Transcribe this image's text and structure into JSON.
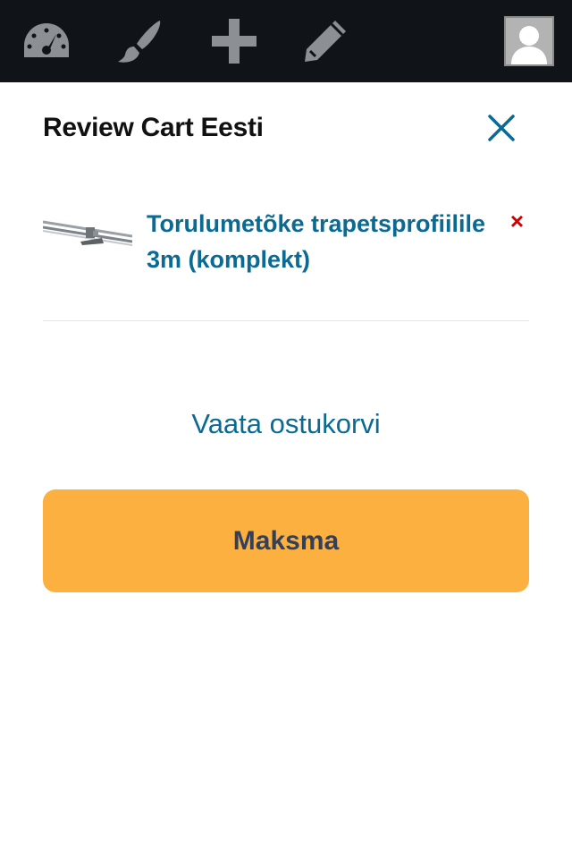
{
  "adminbar": {
    "icons": [
      "dashboard-icon",
      "customize-brush-icon",
      "new-plus-icon",
      "edit-pencil-icon"
    ],
    "avatar": "user-avatar"
  },
  "cart": {
    "title": "Review Cart Eesti",
    "close_icon": "close-icon",
    "items": [
      {
        "name": "Torulumetõke trapetsprofiilile 3m (komplekt)",
        "remove_label": "×"
      }
    ],
    "view_cart_label": "Vaata ostukorvi",
    "checkout_label": "Maksma"
  },
  "colors": {
    "adminbar_bg": "#101418",
    "adminbar_icon": "#8c8f94",
    "link": "#0a6a94",
    "remove": "#d10000",
    "checkout_bg": "#fbb040",
    "checkout_text": "#34405a"
  }
}
